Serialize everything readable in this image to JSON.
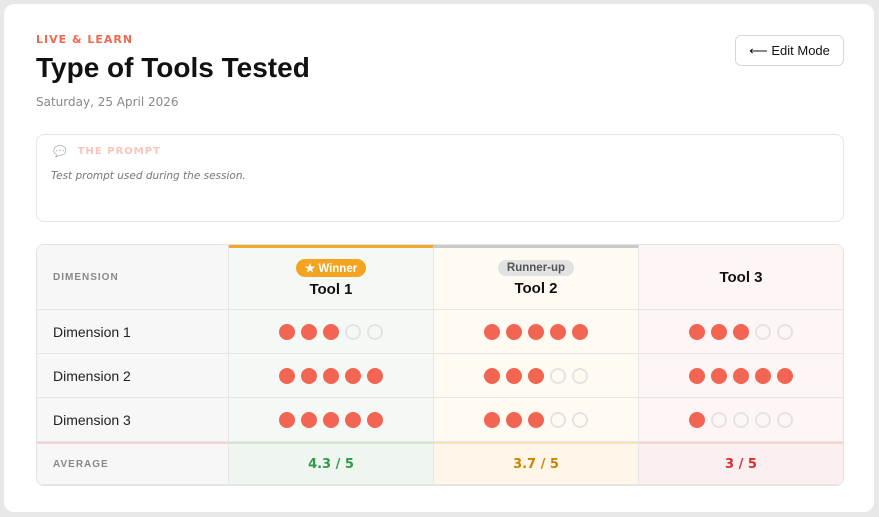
{
  "header": {
    "eyebrow": "LIVE & LEARN",
    "title": "Type of Tools Tested",
    "date": "Saturday, 25 April 2026",
    "edit_button": "⟵ Edit Mode"
  },
  "prompt": {
    "icon": "speech-bubble-icon",
    "label": "THE PROMPT",
    "text": "Test prompt used during the session."
  },
  "table": {
    "dimension_header": "DIMENSION",
    "average_label": "AVERAGE",
    "tools": [
      {
        "name": "Tool 1",
        "badge": "★ Winner",
        "average": "4.3 / 5",
        "color": "#2e9b4a"
      },
      {
        "name": "Tool 2",
        "badge": "Runner-up",
        "average": "3.7 / 5",
        "color": "#cc8400"
      },
      {
        "name": "Tool 3",
        "badge": null,
        "average": "3 / 5",
        "color": "#dd2c2c"
      }
    ],
    "rows": [
      {
        "dimension": "Dimension 1",
        "ratings": [
          3,
          5,
          3
        ]
      },
      {
        "dimension": "Dimension 2",
        "ratings": [
          5,
          3,
          5
        ]
      },
      {
        "dimension": "Dimension 3",
        "ratings": [
          5,
          3,
          1
        ]
      }
    ],
    "max_rating": 5
  }
}
